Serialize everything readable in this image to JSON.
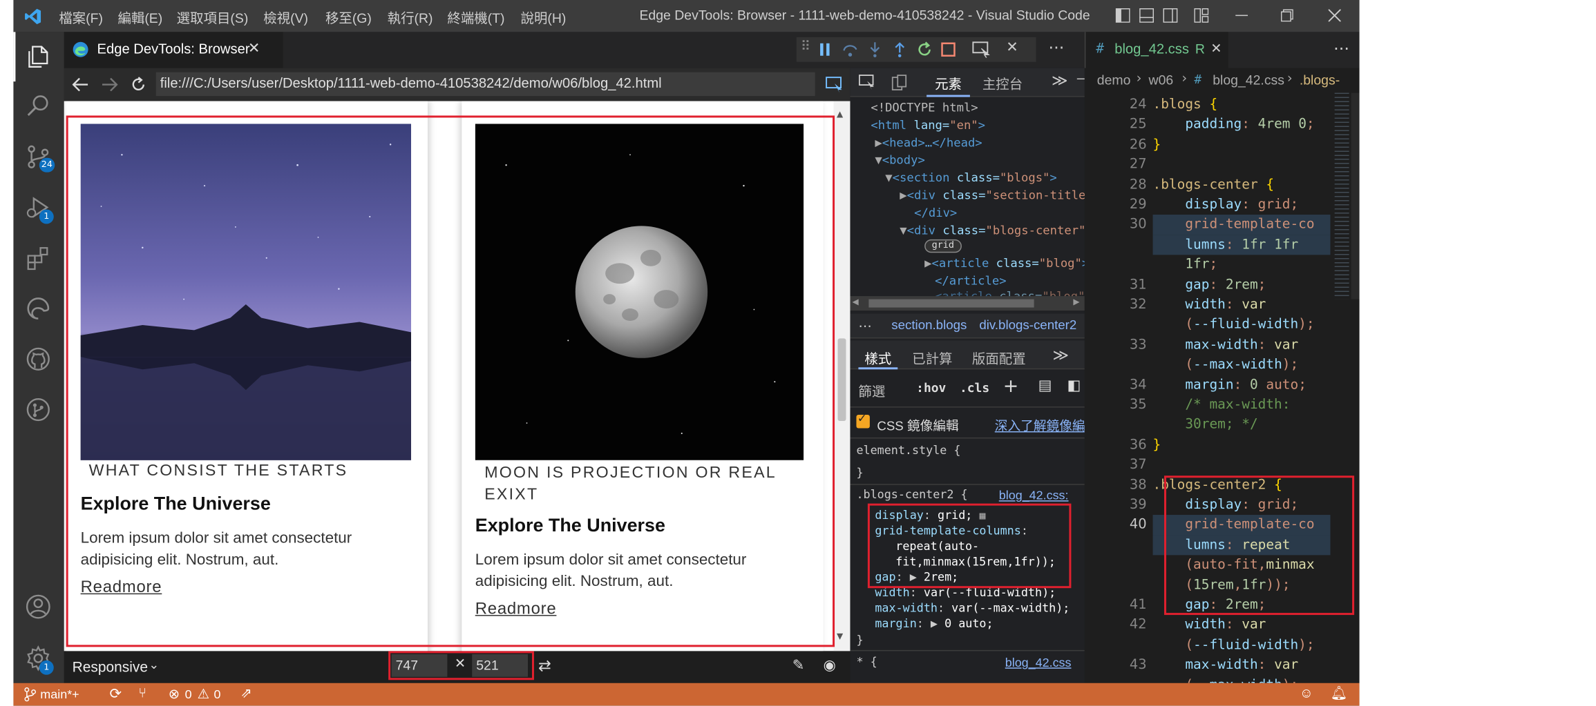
{
  "window": {
    "title": "Edge DevTools: Browser - 1111-web-demo-410538242 - Visual Studio Code",
    "menu": [
      "檔案(F)",
      "編輯(E)",
      "選取項目(S)",
      "檢視(V)",
      "移至(G)",
      "執行(R)",
      "終端機(T)",
      "說明(H)"
    ]
  },
  "activity": {
    "scm_badge": "24",
    "debug_badge": "1",
    "settings_badge": "1"
  },
  "browser_tab": {
    "label": "Edge DevTools: Browser",
    "url": "file:///C:/Users/user/Desktop/1111-web-demo-410538242/demo/w06/blog_42.html"
  },
  "page": {
    "cards": [
      {
        "subtitle": "WHAT CONSIST THE STARTS",
        "title": "Explore The Universe",
        "text": "Lorem ipsum dolor sit amet consectetur adipisicing elit. Nostrum, aut.",
        "link": "Readmore"
      },
      {
        "subtitle": "MOON IS PROJECTION OR REAL EXIXT",
        "title": "Explore The Universe",
        "text": "Lorem ipsum dolor sit amet consectetur adipisicing elit. Nostrum, aut.",
        "link": "Readmore"
      }
    ]
  },
  "device_bar": {
    "mode": "Responsive",
    "width": "747",
    "height": "521"
  },
  "devtools": {
    "tabs": [
      "元素",
      "主控台"
    ],
    "dom": {
      "l1": "<!DOCTYPE html>",
      "html_open": "<html",
      "lang_attr": " lang=",
      "lang_val": "\"en\"",
      "head": "<head>…</head>",
      "body": "<body>",
      "section_cls": "\"blogs\"",
      "section_title_cls": "\"section-title",
      "div_close": "</div>",
      "blogs_center_cls": "\"blogs-center\"",
      "grid_badge": "grid",
      "article_cls": "\"blog\"",
      "article_close": "</article>"
    },
    "breadcrumbs": [
      "section.blogs",
      "div.blogs-center2"
    ],
    "sub_tabs": [
      "樣式",
      "已計算",
      "版面配置"
    ],
    "filter_label": "篩選",
    "hov": ":hov",
    "cls": ".cls",
    "css_mirror_label": "CSS 鏡像編輯",
    "learn_more": "深入了解鏡像編",
    "element_style": "element.style {",
    "close_brace": "}",
    "rule_selector": ".blogs-center2 {",
    "rule_source": "blog_42.css:",
    "rule_source2": "blog_42.css",
    "star_rule": "* {",
    "decls": {
      "display": "display",
      "display_val": "grid;",
      "gtc": "grid-template-columns",
      "gtc_val1": "repeat(auto-",
      "gtc_val2": "fit,minmax(15rem,1fr));",
      "gap": "gap",
      "gap_val": "2rem;",
      "width": "width",
      "width_val": "var(--fluid-width);",
      "maxw": "max-width",
      "maxw_val": "var(--max-width);",
      "margin": "margin",
      "margin_val": "0 auto;"
    }
  },
  "editor": {
    "tab_label": "blog_42.css",
    "tab_badge": "R",
    "breadcrumb": [
      "demo",
      "w06",
      "blog_42.css",
      ".blogs-"
    ],
    "lines": [
      {
        "n": "24",
        "t": ".blogs {"
      },
      {
        "n": "25",
        "t": "    padding: 4rem 0;"
      },
      {
        "n": "26",
        "t": "}"
      },
      {
        "n": "27",
        "t": ""
      },
      {
        "n": "28",
        "t": ".blogs-center {"
      },
      {
        "n": "29",
        "t": "    display: grid;"
      },
      {
        "n": "30",
        "t": "    grid-template-co"
      },
      {
        "n": "",
        "t": "    lumns: 1fr 1fr"
      },
      {
        "n": "",
        "t": "    1fr;"
      },
      {
        "n": "31",
        "t": "    gap: 2rem;"
      },
      {
        "n": "32",
        "t": "    width: var"
      },
      {
        "n": "",
        "t": "    (--fluid-width);"
      },
      {
        "n": "33",
        "t": "    max-width: var"
      },
      {
        "n": "",
        "t": "    (--max-width);"
      },
      {
        "n": "34",
        "t": "    margin: 0 auto;"
      },
      {
        "n": "35",
        "t": "    /* max-width:"
      },
      {
        "n": "",
        "t": "    30rem; */"
      },
      {
        "n": "36",
        "t": "}"
      },
      {
        "n": "37",
        "t": ""
      },
      {
        "n": "38",
        "t": ".blogs-center2 {"
      },
      {
        "n": "39",
        "t": "    display: grid;"
      },
      {
        "n": "40",
        "t": "    grid-template-co"
      },
      {
        "n": "",
        "t": "    lumns: repeat"
      },
      {
        "n": "",
        "t": "    (auto-fit,minmax"
      },
      {
        "n": "",
        "t": "    (15rem,1fr));"
      },
      {
        "n": "41",
        "t": "    gap: 2rem;"
      },
      {
        "n": "42",
        "t": "    width: var"
      },
      {
        "n": "",
        "t": "    (--fluid-width);"
      },
      {
        "n": "43",
        "t": "    max-width: var"
      },
      {
        "n": "",
        "t": "    (--max-width);"
      }
    ]
  },
  "statusbar": {
    "branch": "main*+",
    "errors": "0",
    "warnings": "0"
  }
}
